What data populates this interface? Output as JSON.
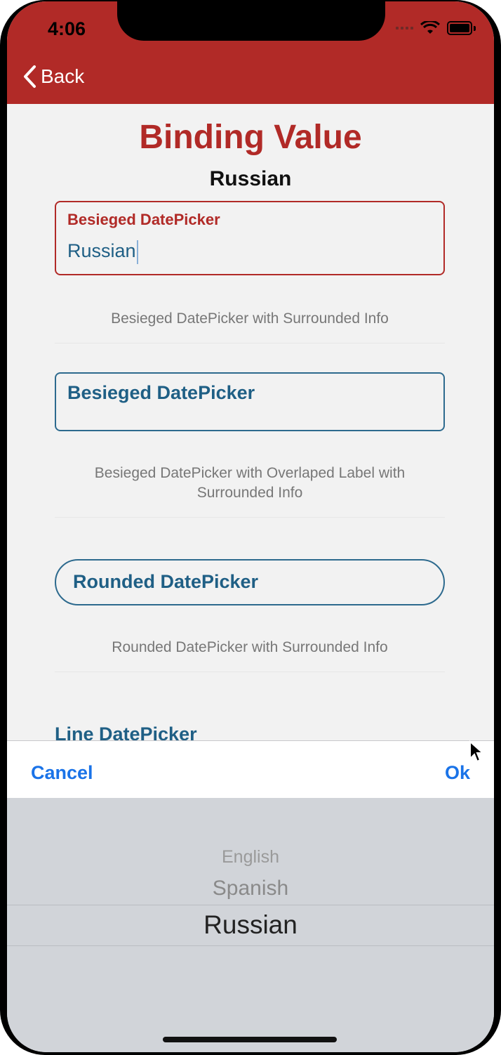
{
  "status": {
    "time": "4:06"
  },
  "nav": {
    "back_label": "Back"
  },
  "page": {
    "title": "Binding Value",
    "selected_value": "Russian"
  },
  "fields": {
    "besieged": {
      "label": "Besieged DatePicker",
      "value": "Russian",
      "info": "Besieged DatePicker with Surrounded Info"
    },
    "overlapped": {
      "label": "Besieged DatePicker",
      "info": "Besieged DatePicker with Overlaped Label with Surrounded Info"
    },
    "rounded": {
      "label": "Rounded DatePicker",
      "info": "Rounded DatePicker with Surrounded Info"
    },
    "line": {
      "label": "Line DatePicker"
    }
  },
  "toolbar": {
    "cancel_label": "Cancel",
    "ok_label": "Ok"
  },
  "picker": {
    "options": [
      "English",
      "Spanish",
      "Russian"
    ],
    "selected": "Russian"
  },
  "colors": {
    "accent": "#b12a27",
    "field_text": "#1f5f85",
    "toolbar_buttons": "#1a73e8"
  }
}
